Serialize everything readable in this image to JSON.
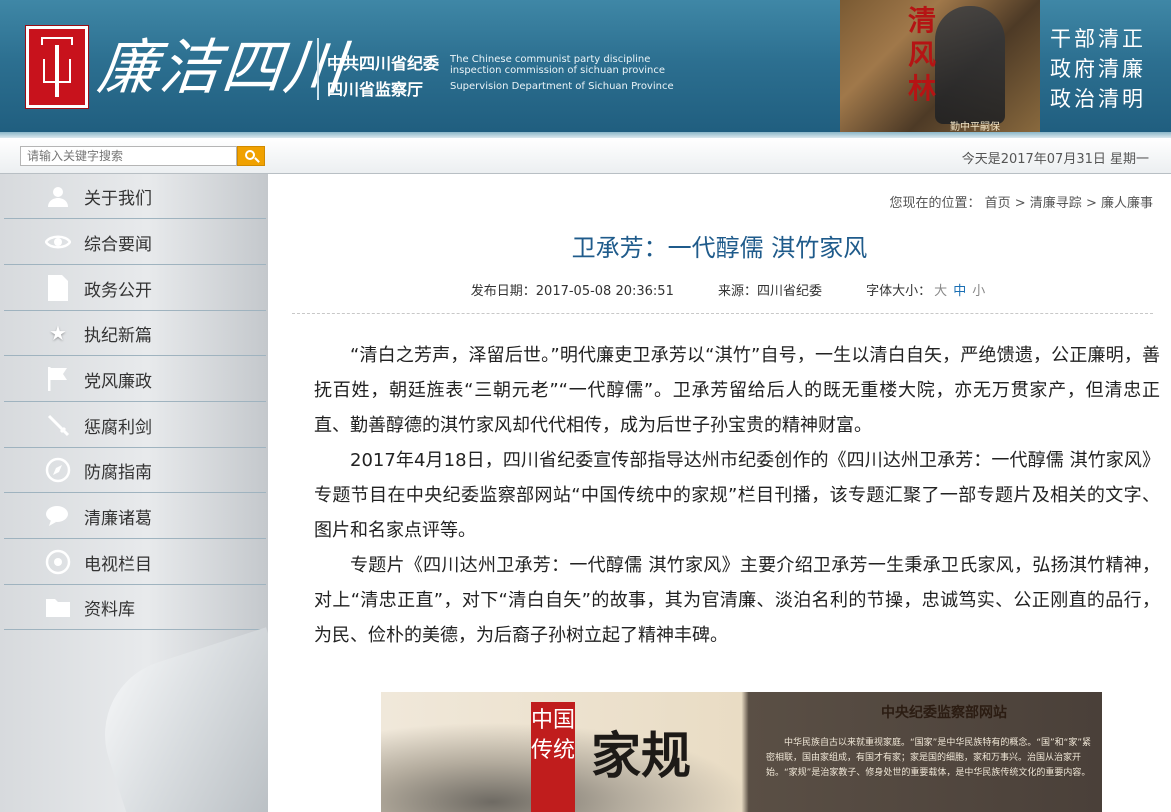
{
  "banner": {
    "logo_text": "廉洁四川",
    "org_cn_1": "中共四川省纪委",
    "org_cn_2": "四川省监察厅",
    "org_en_1": "The Chinese communist party discipline",
    "org_en_2": "inspection commission of sichuan province",
    "org_en_3": "Supervision Department of Sichuan Province",
    "photo_title": "清风林",
    "photo_caption": "勤中平嗣保",
    "slogan": [
      "干部清正",
      "政府清廉",
      "政治清明"
    ]
  },
  "search": {
    "placeholder": "请输入关键字搜索"
  },
  "date_text": "今天是2017年07月31日 星期一",
  "sidebar": {
    "items": [
      {
        "label": "关于我们",
        "icon": "user-icon"
      },
      {
        "label": "综合要闻",
        "icon": "eye-icon"
      },
      {
        "label": "政务公开",
        "icon": "document-icon"
      },
      {
        "label": "执纪新篇",
        "icon": "star-icon"
      },
      {
        "label": "党风廉政",
        "icon": "flag-icon"
      },
      {
        "label": "惩腐利剑",
        "icon": "sword-icon"
      },
      {
        "label": "防腐指南",
        "icon": "compass-icon"
      },
      {
        "label": "清廉诸葛",
        "icon": "chat-icon"
      },
      {
        "label": "电视栏目",
        "icon": "tv-icon"
      },
      {
        "label": "资料库",
        "icon": "folder-icon"
      }
    ]
  },
  "breadcrumb": {
    "prefix": "您现在的位置：",
    "home": "首页",
    "sep": " > ",
    "level1": "清廉寻踪",
    "level2": "廉人廉事"
  },
  "article": {
    "title": "卫承芳：一代醇儒 淇竹家风",
    "date": "发布日期：2017-05-08 20:36:51",
    "source": "来源：四川省纪委",
    "font_size_label": "字体大小：",
    "font_sizes": [
      "大",
      "中",
      "小"
    ],
    "paragraphs": [
      "“清白之芳声，泽留后世。”明代廉吏卫承芳以“淇竹”自号，一生以清白自矢，严绝馈遗，公正廉明，善抚百姓，朝廷旌表“三朝元老”“一代醇儒”。卫承芳留给后人的既无重楼大院，亦无万贯家产，但清忠正直、勤善醇德的淇竹家风却代代相传，成为后世子孙宝贵的精神财富。",
      "2017年4月18日，四川省纪委宣传部指导达州市纪委创作的《四川达州卫承芳：一代醇儒 淇竹家风》专题节目在中央纪委监察部网站“中国传统中的家规”栏目刊播，该专题汇聚了一部专题片及相关的文字、图片和名家点评等。",
      "专题片《四川达州卫承芳：一代醇儒 淇竹家风》主要介绍卫承芳一生秉承卫氏家风，弘扬淇竹精神，对上“清忠正直”，对下“清白自矢”的故事，其为官清廉、淡泊名利的节操，忠诚笃实、公正刚直的品行，为民、俭朴的美德，为后裔子孙树立起了精神丰碑。"
    ],
    "image": {
      "badge": "中国传统",
      "big_text": "家规",
      "site_name": "中央纪委监察部网站",
      "text": "中华民族自古以来就重视家庭。“国家”是中华民族特有的概念。“国”和“家”紧密相联，国由家组成，有国才有家；家是国的细胞，家和万事兴。治国从治家开始。“家规”是治家教子、修身处世的重要载体，是中华民族传统文化的重要内容。"
    }
  }
}
